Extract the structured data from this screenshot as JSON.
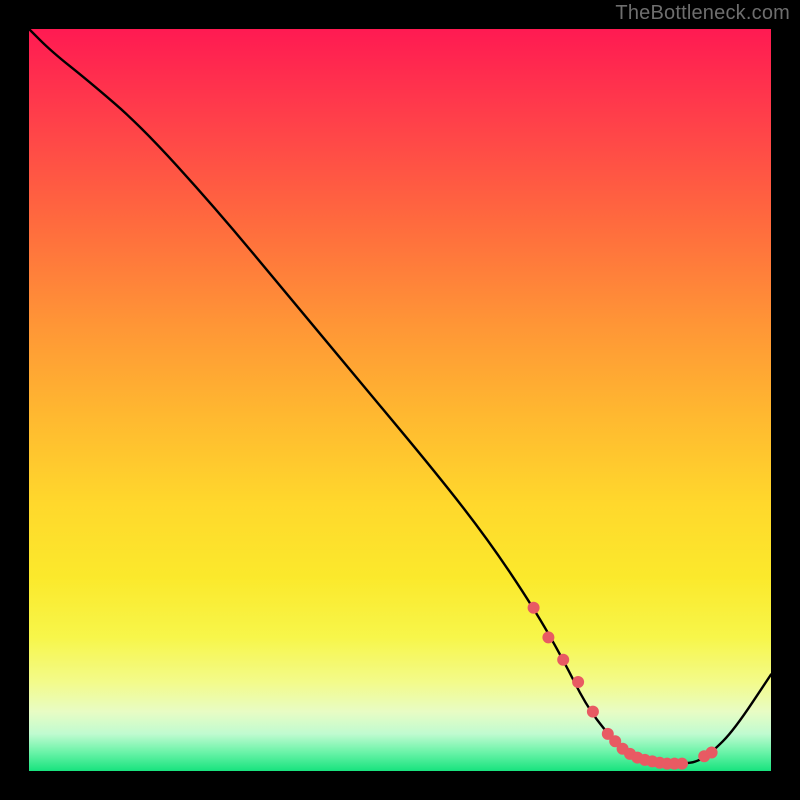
{
  "attribution": "TheBottleneck.com",
  "colors": {
    "background": "#000000",
    "gradient_top": "#ff1a52",
    "gradient_mid": "#ffd82c",
    "gradient_bottom": "#18e37e",
    "curve": "#000000",
    "dots": "#e85a63"
  },
  "chart_data": {
    "type": "line",
    "title": "",
    "xlabel": "",
    "ylabel": "",
    "xlim": [
      0,
      100
    ],
    "ylim": [
      0,
      100
    ],
    "x": [
      0,
      3,
      8,
      15,
      25,
      35,
      45,
      55,
      62,
      68,
      72,
      75,
      78,
      80,
      83,
      86,
      88,
      90,
      92,
      95,
      100
    ],
    "y": [
      100,
      97,
      93,
      87,
      76,
      64,
      52,
      40,
      31,
      22,
      15,
      9,
      5,
      3,
      1.5,
      1,
      1,
      1.2,
      2.5,
      5.5,
      13
    ],
    "series": [
      {
        "name": "curve",
        "x": [
          0,
          3,
          8,
          15,
          25,
          35,
          45,
          55,
          62,
          68,
          72,
          75,
          78,
          80,
          83,
          86,
          88,
          90,
          92,
          95,
          100
        ],
        "y": [
          100,
          97,
          93,
          87,
          76,
          64,
          52,
          40,
          31,
          22,
          15,
          9,
          5,
          3,
          1.5,
          1,
          1,
          1.2,
          2.5,
          5.5,
          13
        ]
      }
    ],
    "highlight_points": {
      "x": [
        68,
        70,
        72,
        74,
        76,
        78,
        79,
        80,
        81,
        82,
        83,
        84,
        85,
        86,
        87,
        88,
        91,
        92
      ],
      "y": [
        22,
        18,
        15,
        12,
        8,
        5,
        4,
        3,
        2.3,
        1.8,
        1.5,
        1.3,
        1.1,
        1,
        1,
        1,
        2.0,
        2.5
      ]
    }
  }
}
